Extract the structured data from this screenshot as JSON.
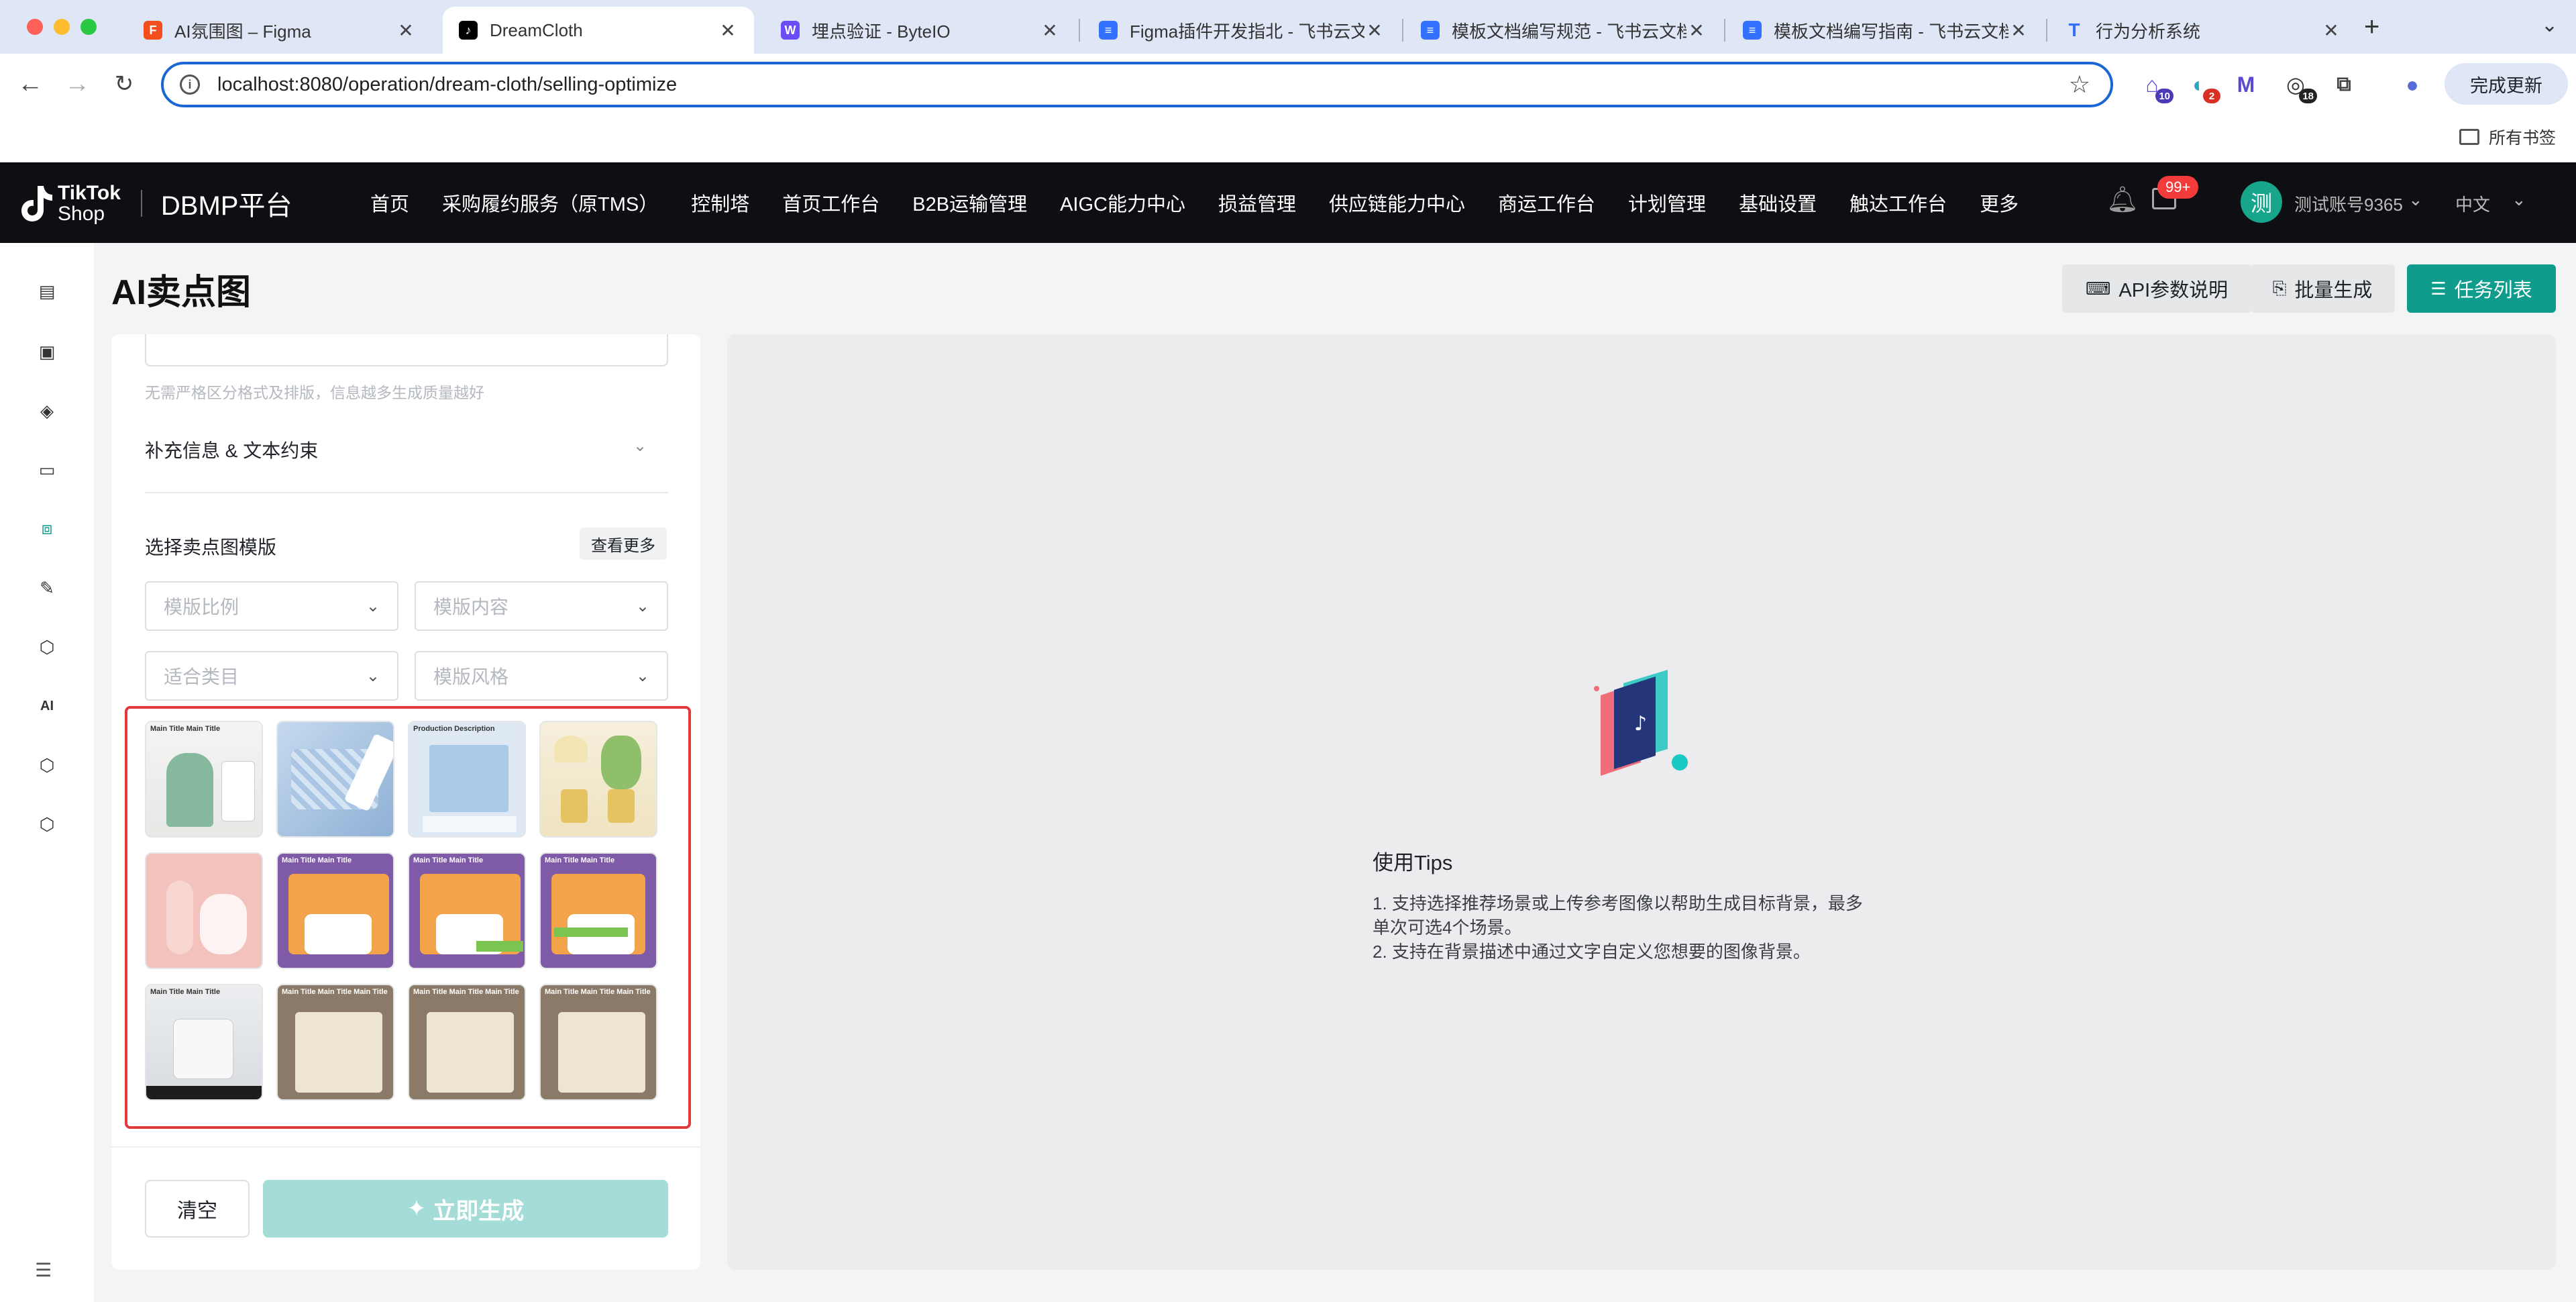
{
  "browser": {
    "tabs": [
      {
        "title": "AI氛围图 – Figma",
        "favicon": "figma-icon",
        "color": "#f24e1e"
      },
      {
        "title": "DreamCloth",
        "favicon": "tiktok-icon",
        "color": "#000000"
      },
      {
        "title": "埋点验证 - ByteIO",
        "favicon": "byteio-icon",
        "color": "#6b4cf6"
      },
      {
        "title": "Figma插件开发指北 - 飞书云文档",
        "favicon": "doc-icon",
        "color": "#3370ff"
      },
      {
        "title": "模板文档编写规范 - 飞书云文档",
        "favicon": "doc-icon",
        "color": "#3370ff"
      },
      {
        "title": "模板文档编写指南 - 飞书云文档",
        "favicon": "doc-icon",
        "color": "#3370ff"
      },
      {
        "title": "行为分析系统",
        "favicon": "tea-icon",
        "color": "#3370ff"
      }
    ],
    "url": "localhost:8080/operation/dream-cloth/selling-optimize",
    "extensions": [
      {
        "name": "extension-1-icon",
        "badge": "10"
      },
      {
        "name": "extension-2-icon",
        "badge": "2"
      },
      {
        "name": "extension-m-icon",
        "label": "M"
      },
      {
        "name": "extension-3-icon",
        "badge": "18"
      },
      {
        "name": "puzzle-icon"
      }
    ],
    "update_label": "完成更新",
    "bookmarks_label": "所有书签"
  },
  "header": {
    "brand_line1": "TikTok",
    "brand_line2": "Shop",
    "platform": "DBMP平台",
    "nav": [
      "首页",
      "采购履约服务（原TMS）",
      "控制塔",
      "首页工作台",
      "B2B运输管理",
      "AIGC能力中心",
      "损益管理",
      "供应链能力中心",
      "商运工作台",
      "计划管理",
      "基础设置",
      "触达工作台",
      "更多"
    ],
    "notif_badge": "99+",
    "avatar_char": "测",
    "username": "测试账号9365",
    "language": "中文"
  },
  "page": {
    "title": "AI卖点图",
    "buttons": {
      "api_doc": "API参数说明",
      "batch": "批量生成",
      "tasks": "任务列表"
    }
  },
  "form": {
    "hint": "无需严格区分格式及排版，信息越多生成质量越好",
    "supplement_label": "补充信息 & 文本约束",
    "template_section_title": "选择卖点图模版",
    "view_more": "查看更多",
    "filters": {
      "ratio": "模版比例",
      "content": "模版内容",
      "category": "适合类目",
      "style": "模版风格"
    },
    "clear": "清空",
    "generate": "立即生成"
  },
  "templates": [
    {
      "caption": "Main Title Main Title"
    },
    {
      "caption": ""
    },
    {
      "caption": "Production Description"
    },
    {
      "caption": ""
    },
    {
      "caption": ""
    },
    {
      "caption": "Main Title Main Title"
    },
    {
      "caption": "Main Title Main Title"
    },
    {
      "caption": "Main Title Main Title"
    },
    {
      "caption": "Main Title Main Title"
    },
    {
      "caption": "Main Title Main Title Main Title"
    },
    {
      "caption": "Main Title Main Title Main Title"
    },
    {
      "caption": "Main Title Main Title Main Title"
    }
  ],
  "tips": {
    "title": "使用Tips",
    "line1": "1. 支持选择推荐场景或上传参考图像以帮助生成目标背景，最多",
    "line2": "单次可选4个场景。",
    "line3": "2. 支持在背景描述中通过文字自定义您想要的图像背景。"
  },
  "colors": {
    "accent": "#109c8c",
    "header_bg": "#0d0f12",
    "highlight_border": "#e23a3a"
  }
}
